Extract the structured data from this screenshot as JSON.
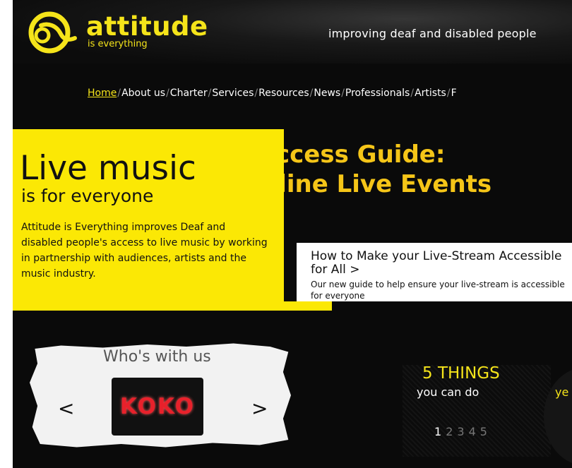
{
  "brand": {
    "name": "attitude",
    "tagline_small": "is everything",
    "accent": "#fbe805"
  },
  "header": {
    "tagline": "improving deaf and disabled people"
  },
  "nav": {
    "items": [
      {
        "label": "Home"
      },
      {
        "label": "About us"
      },
      {
        "label": "Charter"
      },
      {
        "label": "Services"
      },
      {
        "label": "Resources"
      },
      {
        "label": "News"
      },
      {
        "label": "Professionals"
      },
      {
        "label": "Artists"
      },
      {
        "label": "F"
      }
    ]
  },
  "hero": {
    "title_line1": "ccess Guide:",
    "title_line2": "nline Live Events"
  },
  "promo": {
    "title": "Live music",
    "subtitle": "is for everyone",
    "body": "Attitude is Everything improves Deaf and disabled people's access to live music by working in partnership with audiences, artists and the music industry."
  },
  "card": {
    "title": "How to Make your Live-Stream Accessible for All >",
    "sub": "Our new guide to help ensure your live-stream is accessible for everyone"
  },
  "who": {
    "title": "Who's with us",
    "logo": "KOKO",
    "prev": "<",
    "next": ">"
  },
  "five": {
    "title": "5 THINGS",
    "sub": "you can do",
    "peek": "ye"
  },
  "pager": {
    "pages": [
      "1",
      "2",
      "3",
      "4",
      "5"
    ],
    "current": "1"
  }
}
